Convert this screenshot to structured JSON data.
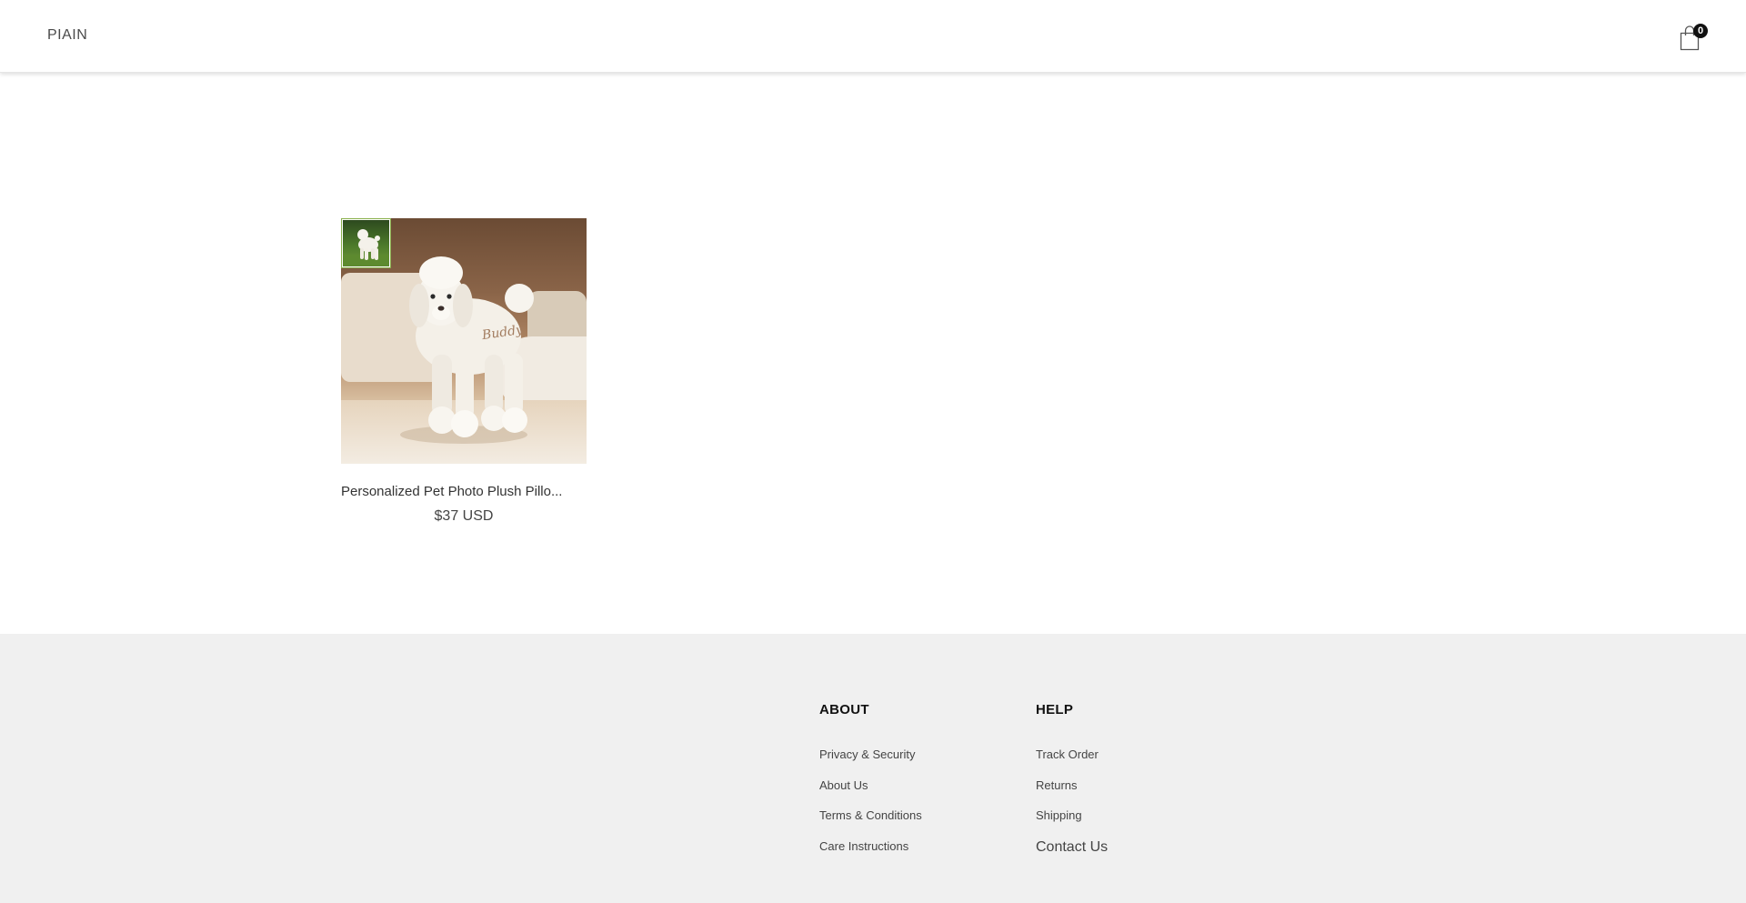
{
  "header": {
    "logo": "PIAIN",
    "cart_icon": "shopping-bag-icon",
    "cart_count": "0"
  },
  "product": {
    "title": "Personalized Pet Photo Plush Pillo...",
    "price": "$37 USD",
    "image_text": "Buddy"
  },
  "footer": {
    "about": {
      "heading": "ABOUT",
      "links": [
        "Privacy & Security",
        "About Us",
        "Terms & Conditions",
        "Care Instructions"
      ]
    },
    "help": {
      "heading": "HELP",
      "links": [
        "Track Order",
        "Returns",
        "Shipping",
        "Contact Us"
      ]
    }
  }
}
